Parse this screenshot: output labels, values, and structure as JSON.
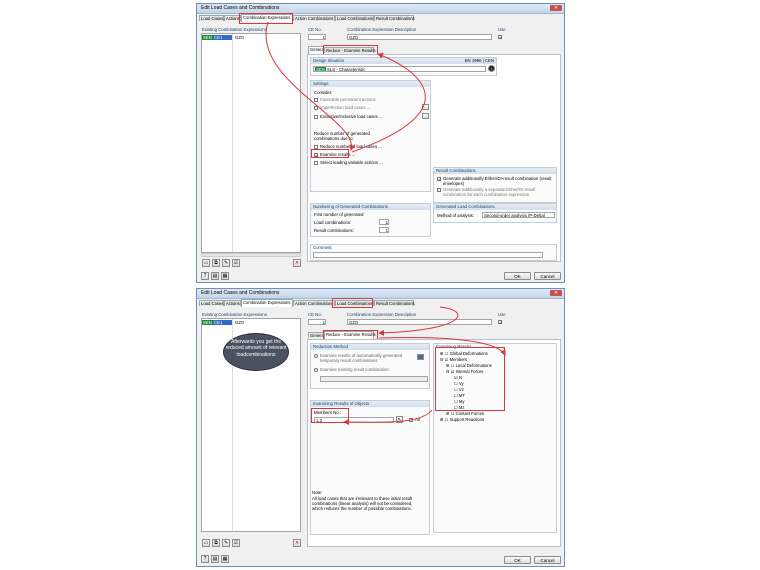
{
  "window": {
    "title": "Edit Load Cases and Combinations",
    "close": "✕"
  },
  "tabs": [
    "Load Cases",
    "Actions",
    "Combination Expressions",
    "Action Combinations",
    "Load Combinations",
    "Result Combinations"
  ],
  "left": {
    "header": "Existing Combination Expressions",
    "item_id": "CE1",
    "item_name": "GZG",
    "item_tag": "SEN"
  },
  "ce": {
    "no_label": "CE No.",
    "no_value": "1",
    "desc_label": "Combination Expression Description",
    "desc_value": "GZG",
    "use_label": "Use",
    "use_check": "✓"
  },
  "subtabs": {
    "general": "General",
    "reduce": "Reduce - Examine Results"
  },
  "win1": {
    "design_situation": {
      "header": "Design Situation",
      "norm": "EN 1990 | CEN",
      "tag": "SEN",
      "value": "SLS - Characteristic"
    },
    "settings": {
      "header": "Settings",
      "consider": "Consider:",
      "opt1": "Favorable permanent actions",
      "opt2": "Imperfection load cases ...",
      "opt3": "Exclusive/Inclusive load cases ...",
      "reduce_label": "Reduce number of generated combinations due to:",
      "red1": "Reduce number of load cases ...",
      "red2": "Examine results ...",
      "red3": "Select leading variable actions ..."
    },
    "result_comb": {
      "header": "Result Combinations",
      "opt1": "Generate additionally Either/Or-result combination (result envelopes)",
      "opt2": "Generate additionally a separate Either/Or-result combination for each combination expression"
    },
    "numbering": {
      "header": "Numbering of Generated Combinations",
      "first": "First number of generated",
      "load": "Load combinations:",
      "load_val": "1",
      "result": "Result combinations:",
      "result_val": "1"
    },
    "generated": {
      "header": "Generated Load Combinations",
      "method_label": "Method of analysis:",
      "method_value": "Second-order analysis (P-Delta)"
    },
    "comment": {
      "header": "Comment"
    }
  },
  "win2": {
    "reduction": {
      "header": "Reduction Method",
      "opt1": "Examine results of automatically generated temporary result combinations",
      "opt2": "Examine existing result combination:"
    },
    "objects": {
      "header": "Examining Results of Objects",
      "members_label": "Members No.:",
      "members_value": "1,3",
      "all": "All"
    },
    "note": {
      "header": "Note:",
      "text": "All load cases that are irrelevant to these initial result combinations (linear analysis) will not be considered, which reduces the number of possible combinations."
    },
    "examine": {
      "header": "Examining Results",
      "global": "Global Deformations",
      "members": "Members",
      "local": "Local Deformations",
      "internal": "Internal Forces",
      "forces": [
        "N",
        "Vy",
        "Vz",
        "MT",
        "My",
        "Mz"
      ],
      "contact": "Contact Forces",
      "support": "Support Reactions"
    }
  },
  "callout": "Afterwards you get the reduced amount of relevant loadcombinations",
  "buttons": {
    "ok": "OK",
    "cancel": "Cancel"
  }
}
